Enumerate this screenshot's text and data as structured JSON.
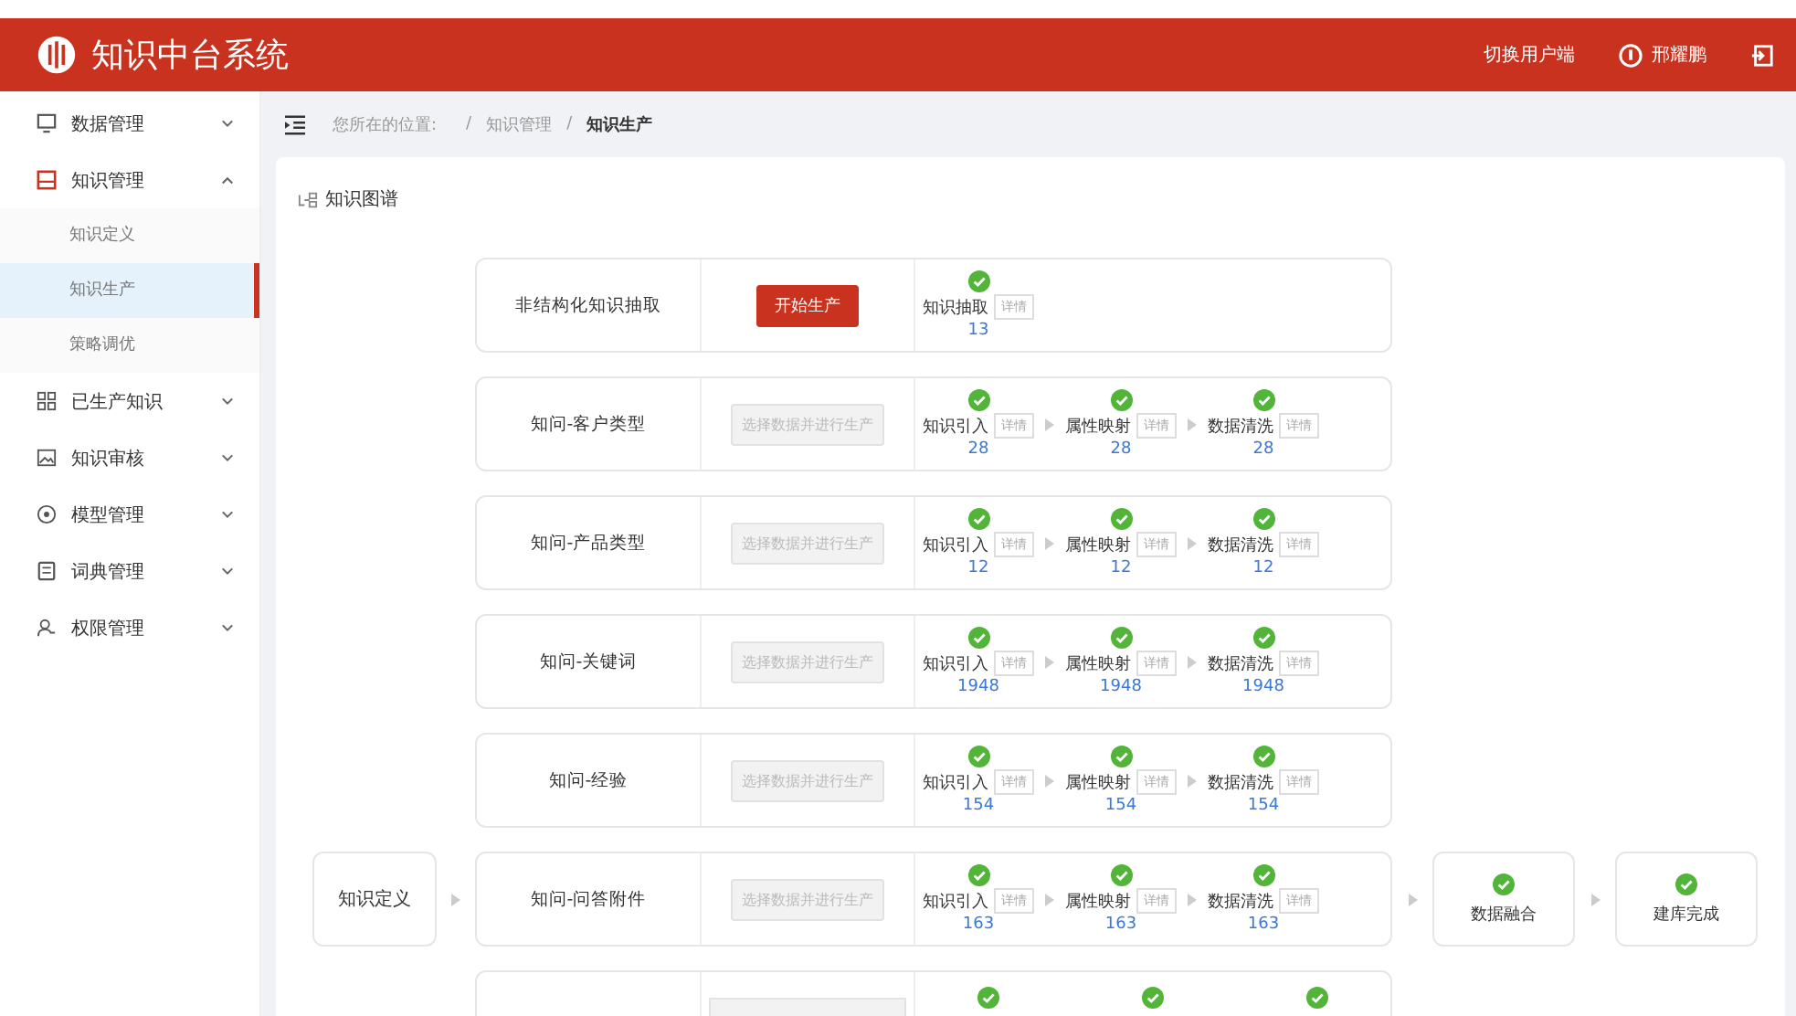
{
  "header": {
    "title": "知识中台系统",
    "switch_link": "切换用户端",
    "user": "邢耀鹏"
  },
  "sidebar": {
    "items": [
      {
        "label": "数据管理",
        "expanded": false
      },
      {
        "label": "知识管理",
        "expanded": true,
        "children": [
          {
            "label": "知识定义",
            "selected": false
          },
          {
            "label": "知识生产",
            "selected": true
          },
          {
            "label": "策略调优",
            "selected": false
          }
        ]
      },
      {
        "label": "已生产知识",
        "expanded": false
      },
      {
        "label": "知识审核",
        "expanded": false
      },
      {
        "label": "模型管理",
        "expanded": false
      },
      {
        "label": "词典管理",
        "expanded": false
      },
      {
        "label": "权限管理",
        "expanded": false
      }
    ]
  },
  "breadcrumb": {
    "prefix": "您所在的位置:",
    "items": [
      {
        "separator": "/",
        "label": "知识管理"
      },
      {
        "separator": "/",
        "label": "知识生产"
      }
    ]
  },
  "card": {
    "title": "知识图谱",
    "source": "知识定义",
    "rows": [
      {
        "kind": "full",
        "name": "非结构化知识抽取",
        "action": {
          "label": "开始生产",
          "disabled": false
        },
        "steps": [
          {
            "label": "知识抽取",
            "detail": "详情",
            "count": "13"
          }
        ]
      },
      {
        "kind": "full",
        "name": "知问-客户类型",
        "action": {
          "label": "选择数据并进行生产",
          "disabled": true
        },
        "steps": [
          {
            "label": "知识引入",
            "detail": "详情",
            "count": "28"
          },
          {
            "label": "属性映射",
            "detail": "详情",
            "count": "28"
          },
          {
            "label": "数据清洗",
            "detail": "详情",
            "count": "28"
          }
        ]
      },
      {
        "kind": "full",
        "name": "知问-产品类型",
        "action": {
          "label": "选择数据并进行生产",
          "disabled": true
        },
        "steps": [
          {
            "label": "知识引入",
            "detail": "详情",
            "count": "12"
          },
          {
            "label": "属性映射",
            "detail": "详情",
            "count": "12"
          },
          {
            "label": "数据清洗",
            "detail": "详情",
            "count": "12"
          }
        ]
      },
      {
        "kind": "full",
        "name": "知问-关键词",
        "action": {
          "label": "选择数据并进行生产",
          "disabled": true
        },
        "steps": [
          {
            "label": "知识引入",
            "detail": "详情",
            "count": "1948"
          },
          {
            "label": "属性映射",
            "detail": "详情",
            "count": "1948"
          },
          {
            "label": "数据清洗",
            "detail": "详情",
            "count": "1948"
          }
        ]
      },
      {
        "kind": "full",
        "name": "知问-经验",
        "action": {
          "label": "选择数据并进行生产",
          "disabled": true
        },
        "steps": [
          {
            "label": "知识引入",
            "detail": "详情",
            "count": "154"
          },
          {
            "label": "属性映射",
            "detail": "详情",
            "count": "154"
          },
          {
            "label": "数据清洗",
            "detail": "详情",
            "count": "154"
          }
        ]
      },
      {
        "kind": "full",
        "name": "知问-问答附件",
        "action": {
          "label": "选择数据并进行生产",
          "disabled": true
        },
        "steps": [
          {
            "label": "知识引入",
            "detail": "详情",
            "count": "163"
          },
          {
            "label": "属性映射",
            "detail": "详情",
            "count": "163"
          },
          {
            "label": "数据清洗",
            "detail": "详情",
            "count": "163"
          }
        ]
      },
      {
        "kind": "partial"
      }
    ],
    "targets": [
      {
        "label": "数据融合"
      },
      {
        "label": "建库完成"
      }
    ]
  }
}
